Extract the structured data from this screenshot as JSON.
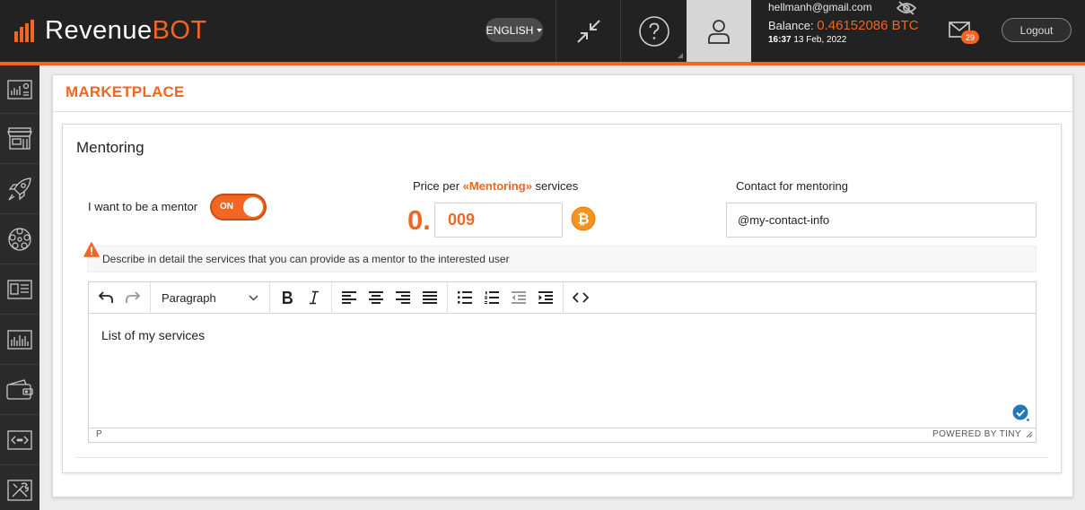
{
  "app": {
    "logo_text_main": "Revenue",
    "logo_text_accent": "BOT",
    "language": "ENGLISH"
  },
  "account": {
    "email": "hellmanh@gmail.com",
    "balance_label": "Balance:",
    "balance_value": "0.46152086 BTC",
    "time": "16:37",
    "date": "13 Feb, 2022",
    "messages_count": "29",
    "logout_label": "Logout"
  },
  "page": {
    "title": "MARKETPLACE"
  },
  "mentoring": {
    "title": "Mentoring",
    "toggle_label": "I want to be a mentor",
    "toggle_state": "ON",
    "price_label_prefix": "Price per ",
    "price_label_highlight": "«Mentoring»",
    "price_label_suffix": " services",
    "price_prefix": "0.",
    "price_value": "009",
    "contact_label": "Contact for mentoring",
    "contact_value": "@my-contact-info",
    "description_hint": "Describe in detail the services that you can provide as a mentor to the interested user"
  },
  "editor": {
    "block_format": "Paragraph",
    "content": "List of my services",
    "status_path": "P",
    "powered_by": "POWERED BY TINY"
  },
  "colors": {
    "accent": "#f26522",
    "topbar": "#222222",
    "sidebar": "#2b2b2b"
  }
}
